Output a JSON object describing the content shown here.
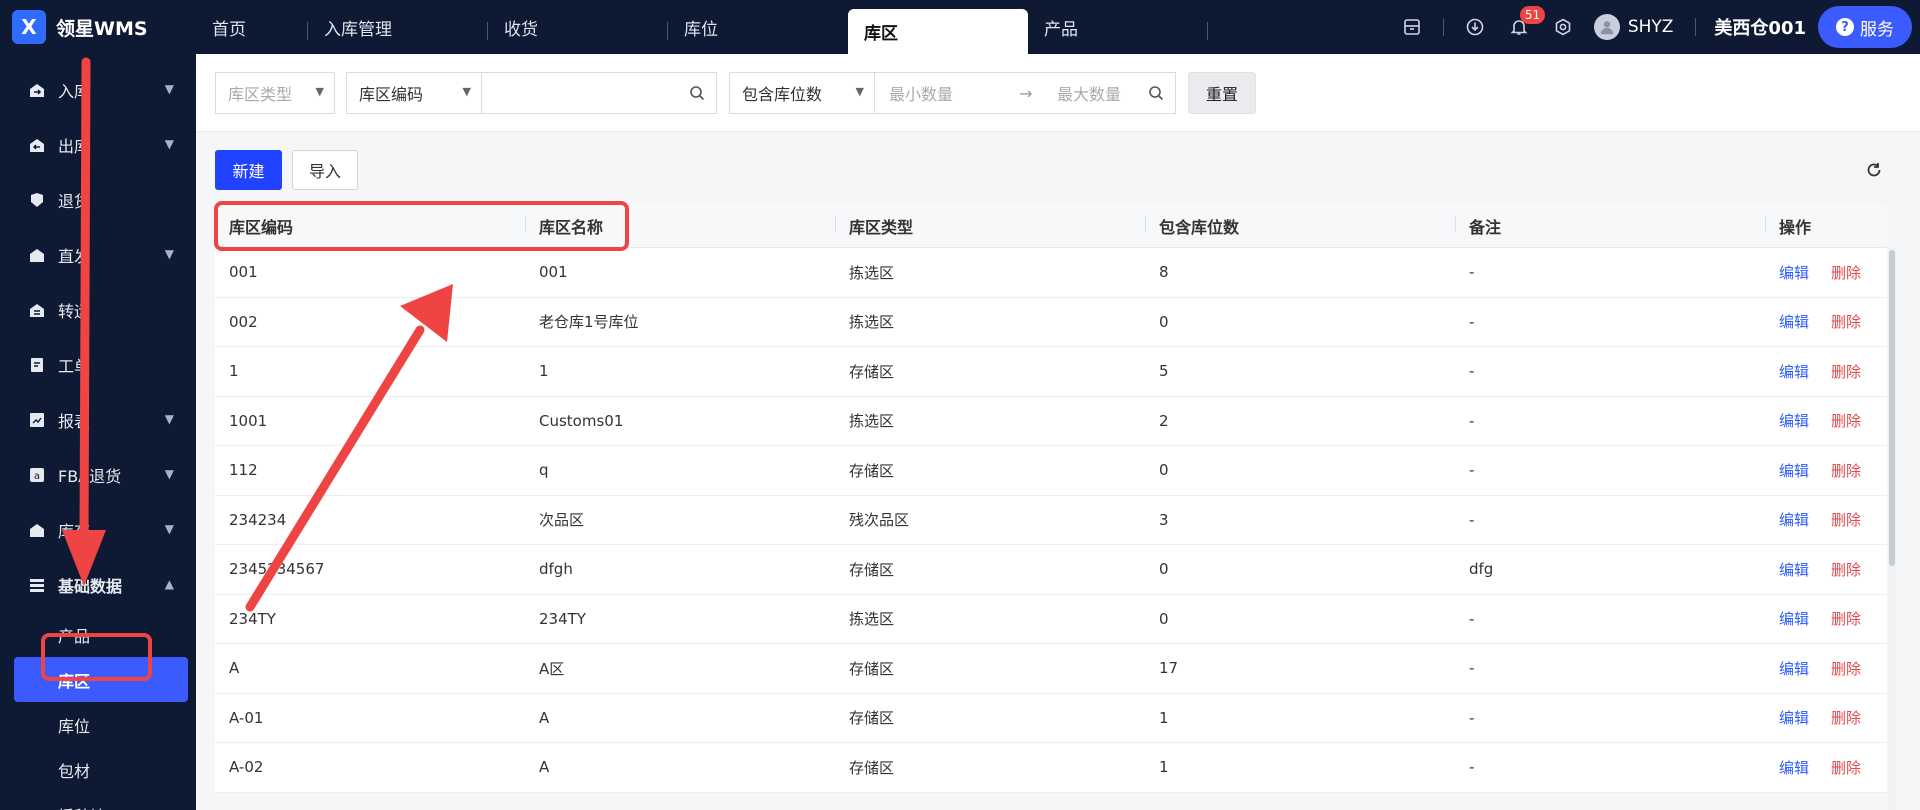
{
  "app": {
    "logo_text": "领星WMS",
    "logo_mark": "X"
  },
  "tabs": [
    {
      "label": "首页"
    },
    {
      "label": "入库管理"
    },
    {
      "label": "收货"
    },
    {
      "label": "库位"
    },
    {
      "label": "库区",
      "active": true
    },
    {
      "label": "产品"
    }
  ],
  "header": {
    "notification_count": "51",
    "username": "SHYZ",
    "warehouse": "美西仓001",
    "service_label": "服务",
    "icons": [
      "archive-icon",
      "download-icon",
      "bell-icon",
      "settings-icon",
      "user-avatar-icon"
    ]
  },
  "sidebar": {
    "items": [
      {
        "label": "入库",
        "icon": "inbound-icon",
        "has_children": true
      },
      {
        "label": "出库",
        "icon": "outbound-icon",
        "has_children": true
      },
      {
        "label": "退货",
        "icon": "return-icon",
        "has_children": false
      },
      {
        "label": "直发",
        "icon": "direct-icon",
        "has_children": true
      },
      {
        "label": "转运",
        "icon": "transfer-icon",
        "has_children": false
      },
      {
        "label": "工单",
        "icon": "workorder-icon",
        "has_children": false
      },
      {
        "label": "报表",
        "icon": "report-icon",
        "has_children": true
      },
      {
        "label": "FBA退货",
        "icon": "amazon-icon",
        "has_children": true
      },
      {
        "label": "库存",
        "icon": "inventory-icon",
        "has_children": true
      },
      {
        "label": "基础数据",
        "icon": "base-data-icon",
        "has_children": true,
        "open": true
      }
    ],
    "sub_items": [
      {
        "label": "产品"
      },
      {
        "label": "库区",
        "active": true
      },
      {
        "label": "库位"
      },
      {
        "label": "包材"
      },
      {
        "label": "播种墙"
      }
    ]
  },
  "filters": {
    "zone_type_placeholder": "库区类型",
    "code_select": "库区编码",
    "search_value": "",
    "location_count_select": "包含库位数",
    "min_placeholder": "最小数量",
    "max_placeholder": "最大数量",
    "reset_label": "重置"
  },
  "toolbar": {
    "new_label": "新建",
    "import_label": "导入"
  },
  "table": {
    "columns": [
      "库区编码",
      "库区名称",
      "库区类型",
      "包含库位数",
      "备注",
      "操作"
    ],
    "action_edit": "编辑",
    "action_delete": "删除",
    "rows": [
      [
        "001",
        "001",
        "拣选区",
        "8",
        "-"
      ],
      [
        "002",
        "老仓库1号库位",
        "拣选区",
        "0",
        "-"
      ],
      [
        "1",
        "1",
        "存储区",
        "5",
        "-"
      ],
      [
        "1001",
        "Customs01",
        "拣选区",
        "2",
        "-"
      ],
      [
        "112",
        "q",
        "存储区",
        "0",
        "-"
      ],
      [
        "234234",
        "次品区",
        "残次品区",
        "3",
        "-"
      ],
      [
        "2345234567",
        "dfgh",
        "存储区",
        "0",
        "dfg"
      ],
      [
        "234TY",
        "234TY",
        "拣选区",
        "0",
        "-"
      ],
      [
        "A",
        "A区",
        "存储区",
        "17",
        "-"
      ],
      [
        "A-01",
        "A",
        "存储区",
        "1",
        "-"
      ],
      [
        "A-02",
        "A",
        "存储区",
        "1",
        "-"
      ]
    ]
  },
  "colors": {
    "sidebar_bg": "#0e1a33",
    "accent": "#3b5bff",
    "annotation": "#ef4444",
    "delete": "#e5484d"
  }
}
